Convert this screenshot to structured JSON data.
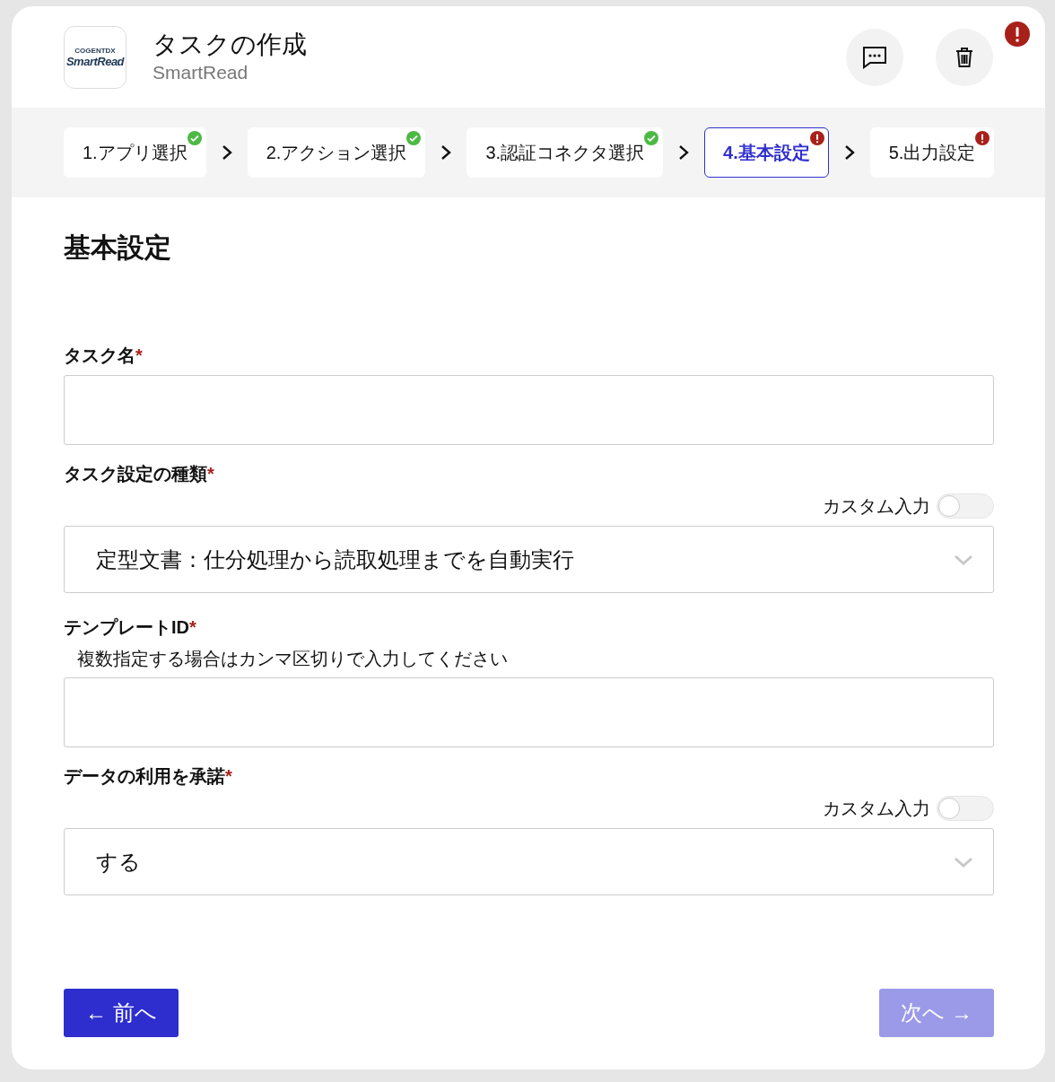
{
  "header": {
    "logo_top": "COGENTDX",
    "logo_brand": "SmartRead",
    "title": "タスクの作成",
    "subtitle": "SmartRead",
    "alert": true
  },
  "steps": [
    {
      "label": "1.アプリ選択",
      "selected": false,
      "complete": true
    },
    {
      "label": "2.アクション選択",
      "selected": false,
      "complete": true
    },
    {
      "label": "3.認証コネクタ選択",
      "selected": false,
      "complete": true
    },
    {
      "label": "4.基本設定",
      "selected": true,
      "complete": false
    },
    {
      "label": "5.出力設定",
      "selected": false,
      "complete": false
    }
  ],
  "section_title": "基本設定",
  "fields": [
    {
      "kind": "text",
      "label": "タスク名",
      "required_mark": "*"
    },
    {
      "kind": "select",
      "label": "タスク設定の種類",
      "required_mark": "*",
      "toggle": {
        "label": "カスタム入力",
        "on": false
      },
      "value": "定型文書：仕分処理から読取処理までを自動実行"
    },
    {
      "kind": "text",
      "label": "テンプレートID",
      "required_mark": "*",
      "hint": "複数指定する場合はカンマ区切りで入力してください"
    },
    {
      "kind": "select",
      "label": "データの利用を承諾",
      "required_mark": "*",
      "toggle": {
        "label": "カスタム入力",
        "on": false
      },
      "value": "する"
    }
  ],
  "buttons": [
    {
      "label": "← 前へ",
      "disabled": false
    },
    {
      "label": "次へ →",
      "disabled": true
    }
  ]
}
